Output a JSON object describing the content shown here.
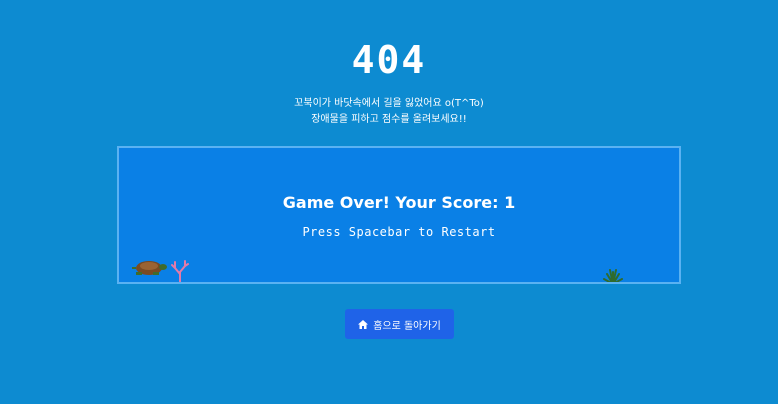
{
  "header": {
    "title": "404",
    "line1": "꼬북이가 바닷속에서 길을 잃었어요 o(T^To)",
    "line2": "장애물을 피하고 점수를 올려보세요!!"
  },
  "game": {
    "game_over_text": "Game Over! Your Score: 1",
    "score": 1,
    "restart_hint": "Press Spacebar to Restart"
  },
  "home_button": {
    "label": "홈으로 돌아가기",
    "icon": "home-icon"
  },
  "colors": {
    "background": "#0d8bd1",
    "game_area": "#0a80e6",
    "game_border": "#5ab2f2",
    "button": "#1f63e8"
  }
}
